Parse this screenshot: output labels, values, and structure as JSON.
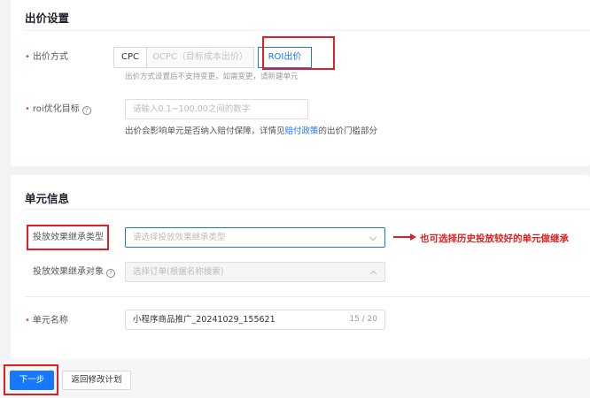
{
  "bid_section": {
    "title": "出价设置",
    "bid_method": {
      "label": "出价方式",
      "options": [
        "CPC",
        "OCPC（目标成本出价）",
        "ROI出价"
      ],
      "selected": "ROI出价",
      "hint": "出价方式设置后不支持变更，如需变更，请新建单元"
    },
    "roi_target": {
      "label": "roi优化目标",
      "placeholder": "请输入0.1~100.00之间的数字",
      "hint_prefix": "出价会影响单元是否纳入赔付保障，详情见",
      "hint_link": "赔付政策",
      "hint_suffix": "的出价门槛部分"
    }
  },
  "unit_section": {
    "title": "单元信息",
    "inherit_type": {
      "label": "投放效果继承类型",
      "placeholder": "请选择投放效果继承类型"
    },
    "inherit_object": {
      "label": "投放效果继承对象",
      "placeholder": "选择订单(根据名称搜索)"
    },
    "unit_name": {
      "label": "单元名称",
      "value": "小程序商品推广_20241029_155621",
      "counter": "15 / 20"
    }
  },
  "annotation": {
    "text": "也可选择历史投放较好的单元做继承",
    "color": "#e02020"
  },
  "footer": {
    "next_label": "下一步",
    "back_label": "返回修改计划"
  },
  "colors": {
    "primary": "#1677ff",
    "required": "#e34d59",
    "annotation": "#e02020"
  },
  "icons": {
    "help": "question-circle-icon",
    "dropdown": "chevron-down-icon"
  }
}
